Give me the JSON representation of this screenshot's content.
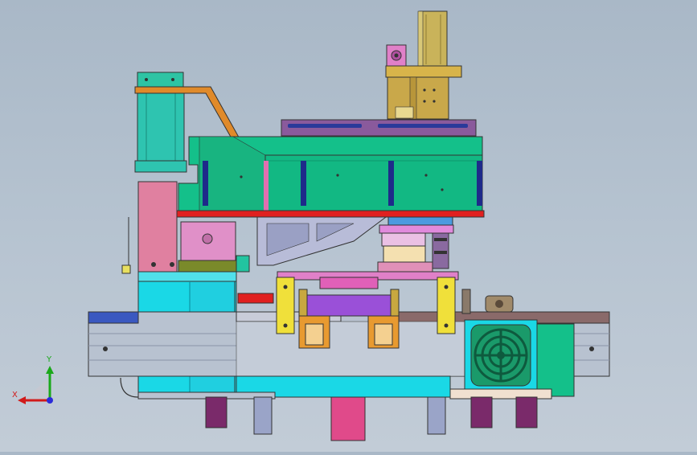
{
  "viewport": {
    "background_top": "#a9b8c7",
    "background_bottom": "#c2ccd7"
  },
  "triad": {
    "x_label": "X",
    "y_label": "Y",
    "x_color": "#d11a1a",
    "y_color": "#1aa81a",
    "z_color": "#2b2bd9"
  },
  "palette": {
    "teal": "#14c08a",
    "cyan": "#1ad8e6",
    "orange": "#e08a2a",
    "pink": "#e07aa0",
    "magenta": "#e070d8",
    "yellow": "#f0e03a",
    "navy": "#1e2a8a",
    "red": "#e02020",
    "purple": "#7a4a9a",
    "gold": "#c8a040",
    "gray_rail": "#b8c2d0",
    "fan_green": "#1a9a6a"
  }
}
